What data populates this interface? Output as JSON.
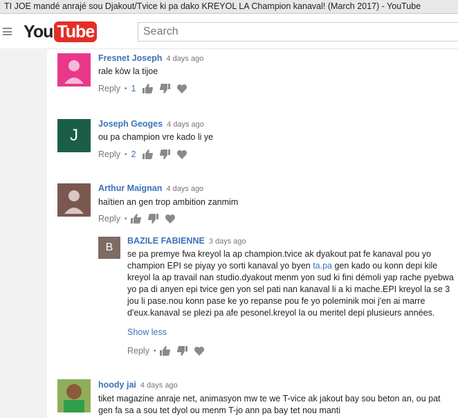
{
  "window": {
    "title": "TI JOE mandé anrajé sou Djakout/Tvice ki pa dako KREYOL LA Champion kanaval! (March 2017) - YouTube"
  },
  "header": {
    "logo_you": "You",
    "logo_tube": "Tube",
    "search_placeholder": "Search"
  },
  "colors": {
    "link": "#3b73b9",
    "yt_red": "#e52d27"
  },
  "comments": [
    {
      "author": "Fresnet Joseph",
      "time": "4 days ago",
      "text": "rale kòw la tijoe",
      "reply_label": "Reply",
      "likes": "1",
      "avatar_color": "#e8388a"
    },
    {
      "author": "Joseph Geoges",
      "time": "4 days ago",
      "text": "ou pa champion vre kado li ye",
      "reply_label": "Reply",
      "likes": "2",
      "avatar_letter": "J",
      "avatar_color": "#1b5e46"
    },
    {
      "author": "Arthur Maignan",
      "time": "4 days ago",
      "text": "haïtien an gen trop ambition zanmim",
      "reply_label": "Reply",
      "avatar_color": "#7a5850"
    },
    {
      "author": "BAZILE FABIENNE",
      "time": "3 days ago",
      "text_before_link": "se pa premye fwa kreyol la ap champion.tvice ak dyakout pat fe kanaval pou yo champion EPI se piyay yo sorti kanaval yo byen ",
      "link_text": "ta.pa",
      "text_after_link": " gen kado ou konn depi kile kreyol la ap travail nan studio.dyakout menm yon sud ki fini démoli yap rache pyebwa yo pa di anyen epi tvice gen yon sel pati nan kanaval li a ki mache.EPI kreyol la se 3 jou li pase.nou konn pase ke yo repanse pou fe yo poleminik moi j'en ai marre d'eux.kanaval se plezi pa afe pesonel.kreyol la ou meritel depi plusieurs années.",
      "show_less": "Show less",
      "reply_label": "Reply",
      "avatar_letter": "B",
      "avatar_color": "#7d6b64"
    },
    {
      "author": "hoody jai",
      "time": "4 days ago",
      "text": "tiket magazine anraje net, animasyon mw te we T-vice ak jakout bay sou beton an, ou pat gen fa sa a sou tet dyol ou menm T-jo ann pa bay tet nou manti",
      "avatar_color": "#6a8a3a"
    }
  ],
  "icons": [
    "thumbs-up-icon",
    "thumbs-down-icon",
    "heart-icon",
    "hamburger-menu-icon",
    "default-avatar-icon"
  ]
}
